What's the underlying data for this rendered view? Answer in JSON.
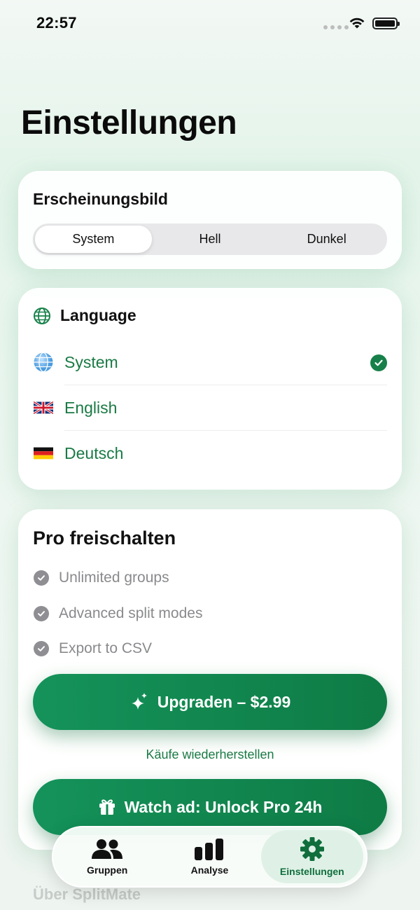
{
  "status_bar": {
    "time": "22:57"
  },
  "page": {
    "title": "Einstellungen"
  },
  "appearance": {
    "title": "Erscheinungsbild",
    "options": [
      "System",
      "Hell",
      "Dunkel"
    ],
    "selected": "System"
  },
  "language": {
    "title": "Language",
    "options": [
      {
        "label": "System",
        "icon": "globe-icon",
        "selected": true
      },
      {
        "label": "English",
        "icon": "uk-flag-icon",
        "selected": false
      },
      {
        "label": "Deutsch",
        "icon": "germany-flag-icon",
        "selected": false
      }
    ]
  },
  "pro": {
    "title": "Pro freischalten",
    "features": [
      "Unlimited groups",
      "Advanced split modes",
      "Export to CSV"
    ],
    "upgrade_label": "Upgraden – $2.99",
    "restore_label": "Käufe wiederherstellen",
    "watch_ad_label": "Watch ad: Unlock Pro 24h"
  },
  "tabbar": {
    "tabs": [
      {
        "label": "Gruppen",
        "icon": "people-icon"
      },
      {
        "label": "Analyse",
        "icon": "bar-chart-icon"
      },
      {
        "label": "Einstellungen",
        "icon": "gear-icon"
      }
    ],
    "active": "Einstellungen"
  },
  "footer": {
    "about_label": "Über SplitMate"
  },
  "colors": {
    "accent": "#17804a",
    "accent_text": "#1a7a45",
    "segment_bg": "#e8e8ea"
  }
}
